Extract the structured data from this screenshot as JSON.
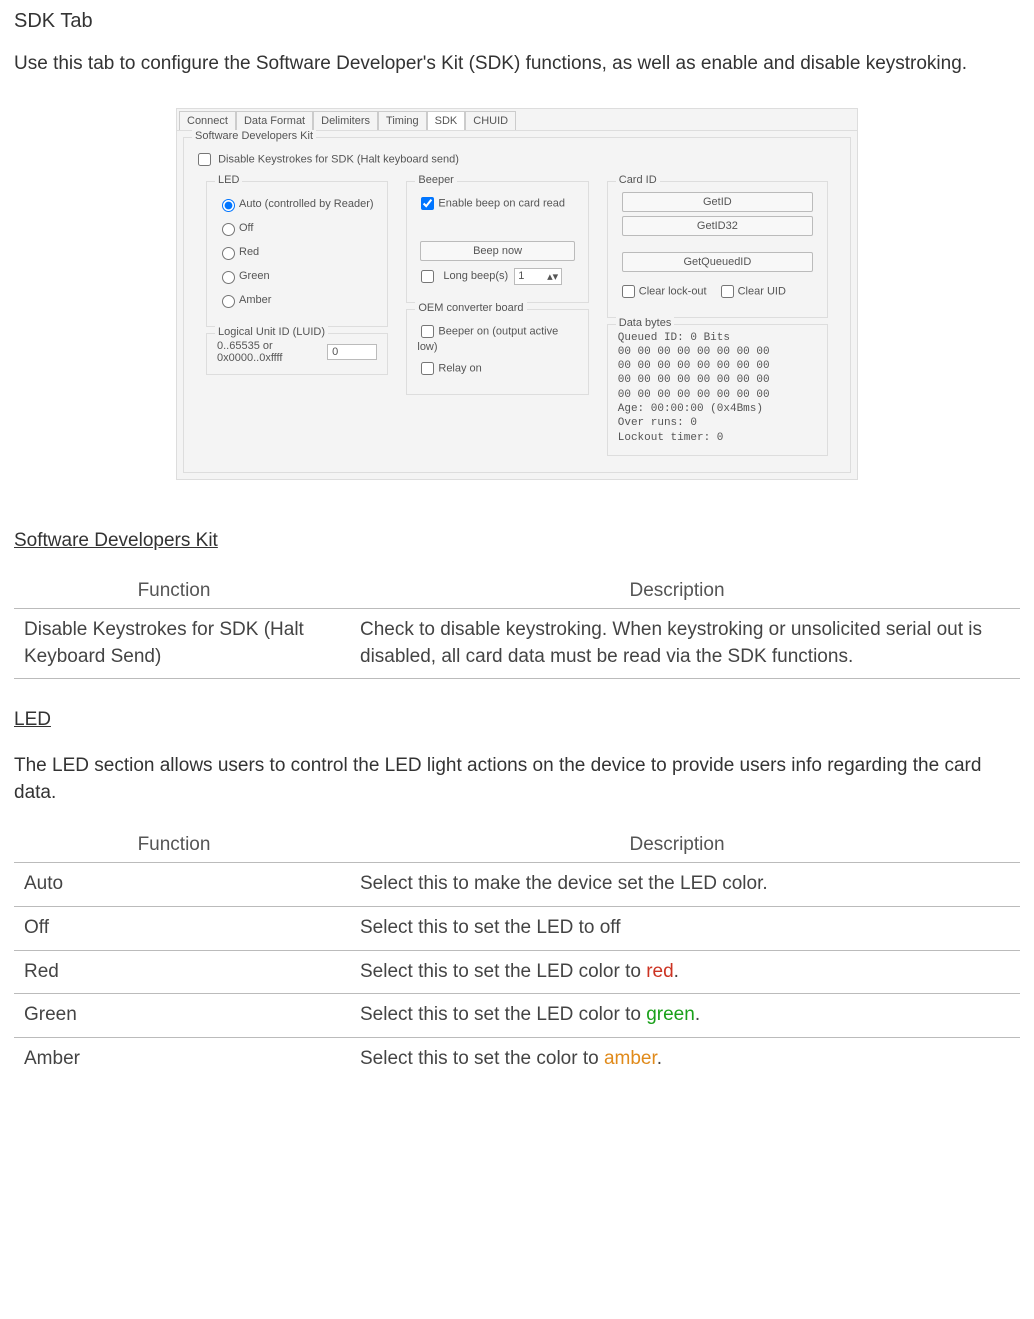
{
  "page": {
    "heading": "SDK Tab",
    "intro": "Use this tab to configure the Software Developer's Kit (SDK) functions,  as well as enable and disable keystroking."
  },
  "dialog": {
    "tabs": [
      "Connect",
      "Data Format",
      "Delimiters",
      "Timing",
      "SDK",
      "CHUID"
    ],
    "active_tab": "SDK",
    "group_title": "Software Developers Kit",
    "disable_ks_label": "Disable Keystrokes for SDK (Halt keyboard send)",
    "led": {
      "title": "LED",
      "options": [
        "Auto (controlled by Reader)",
        "Off",
        "Red",
        "Green",
        "Amber"
      ],
      "selected": 0
    },
    "luid": {
      "title": "Logical Unit ID (LUID)",
      "range": "0..65535 or 0x0000..0xffff",
      "value": "0"
    },
    "beeper": {
      "title": "Beeper",
      "enable_label": "Enable beep on card read",
      "beep_btn": "Beep now",
      "long_label": "Long beep(s)",
      "long_value": "1"
    },
    "oem": {
      "title": "OEM converter board",
      "beeper_label": "Beeper on (output active low)",
      "relay_label": "Relay on"
    },
    "cardid": {
      "title": "Card ID",
      "btn_getid": "GetID",
      "btn_getid32": "GetID32",
      "btn_getqueued": "GetQueuedID",
      "clear_lockout": "Clear lock-out",
      "clear_uid": "Clear UID"
    },
    "databytes": {
      "title": "Data bytes",
      "line1": "Queued ID: 0 Bits",
      "row": "00 00 00 00 00 00 00 00",
      "age": "Age: 00:00:00 (0x4Bms)",
      "overruns": "Over runs: 0",
      "lockout": "Lockout timer: 0"
    }
  },
  "sdk_section": {
    "heading": "Software Developers Kit",
    "table": {
      "headers": [
        "Function",
        "Description"
      ],
      "rows": [
        {
          "fn": "Disable Keystrokes for SDK (Halt Keyboard Send)",
          "desc": "Check to disable keystroking. When keystroking or unsolicited serial out is disabled, all card data must be read via the SDK functions."
        }
      ]
    }
  },
  "led_section": {
    "heading": "LED",
    "intro": "The LED section  allows  users to control the LED light actions on the device to provide users info regarding the card data.",
    "table": {
      "headers": [
        "Function",
        "Description"
      ],
      "rows": [
        {
          "fn": "Auto",
          "desc": "Select this to make the device set the LED color."
        },
        {
          "fn": "Off",
          "desc": "Select this to set the LED to off"
        },
        {
          "fn": "Red",
          "fn_class": "red",
          "desc_pre": "Select this to set the LED color  to ",
          "desc_color_word": "red",
          "desc_color_class": "red",
          "desc_post": "."
        },
        {
          "fn": "Green",
          "fn_class": "green",
          "desc_pre": "Select this to set the LED color  to ",
          "desc_color_word": "green",
          "desc_color_class": "green",
          "desc_post": "."
        },
        {
          "fn": "Amber",
          "fn_class": "amber",
          "desc_pre": "Select this to set the color to ",
          "desc_color_word": "amber",
          "desc_color_class": "amber",
          "desc_post": "."
        }
      ]
    }
  }
}
